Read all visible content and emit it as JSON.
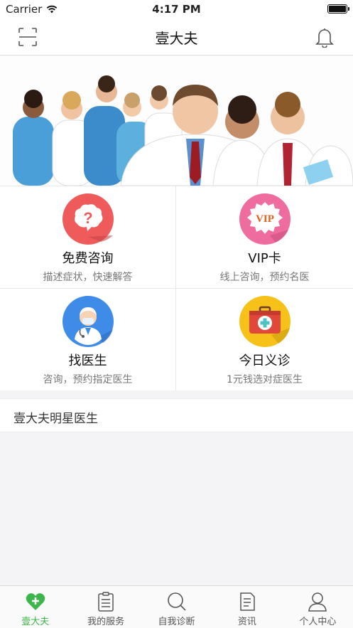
{
  "status_bar": {
    "carrier": "Carrier",
    "time": "4:17 PM"
  },
  "nav": {
    "title": "壹大夫",
    "scan_icon": "scan-icon",
    "bell_icon": "bell-icon"
  },
  "banner": {
    "image": "doctors-group-photo"
  },
  "services": [
    {
      "label": "免费咨询",
      "sub": "描述症状，快速解答",
      "icon": "question-bubble-icon",
      "color": "#ef5b5b"
    },
    {
      "label": "VIP卡",
      "sub": "线上咨询，预约名医",
      "icon": "vip-badge-icon",
      "color": "#ef6d9e"
    },
    {
      "label": "找医生",
      "sub": "咨询，预约指定医生",
      "icon": "doctor-icon",
      "color": "#3f8be8"
    },
    {
      "label": "今日义诊",
      "sub": "1元钱选对症医生",
      "icon": "medical-kit-icon",
      "color": "#f6c21a"
    }
  ],
  "section": {
    "title": "壹大夫明星医生"
  },
  "tabs": [
    {
      "label": "壹大夫",
      "icon": "heart-plus-icon",
      "active": true
    },
    {
      "label": "我的服务",
      "icon": "clipboard-icon",
      "active": false
    },
    {
      "label": "自我诊断",
      "icon": "search-icon",
      "active": false
    },
    {
      "label": "资讯",
      "icon": "document-icon",
      "active": false
    },
    {
      "label": "个人中心",
      "icon": "person-icon",
      "active": false
    }
  ],
  "colors": {
    "accent": "#3cb54a",
    "background": "#f4f4f6"
  }
}
